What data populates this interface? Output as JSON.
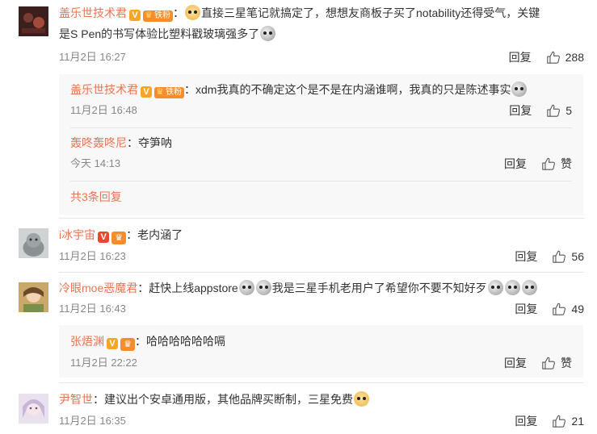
{
  "comments": [
    {
      "user": "盖乐世技术君",
      "text_a": "直接三星笔记就搞定了，想想友商板子买了notability还得受气，关键",
      "text_b": "是S Pen的书写体验比塑料戳玻璃强多了",
      "time": "11月2日 16:27",
      "reply": "回复",
      "likes": "288",
      "fan_badge": "铁粉",
      "vbadge": "V"
    },
    {
      "user": "i冰宇宙",
      "text": "老内涵了",
      "time": "11月2日 16:23",
      "reply": "回复",
      "likes": "56",
      "vbadge": "V"
    },
    {
      "user": "冷眼moe恶魔君",
      "text_a": "赶快上线appstore",
      "text_b": "我是三星手机老用户了希望你不要不知好歹",
      "time": "11月2日 16:43",
      "reply": "回复",
      "likes": "49"
    },
    {
      "user": "尹智世",
      "text": "建议出个安卓通用版，其他品牌买断制，三星免费",
      "time": "11月2日 16:35",
      "reply": "回复",
      "likes": "21"
    }
  ],
  "subs1": [
    {
      "user": "盖乐世技术君",
      "text": "xdm我真的不确定这个是不是在内涵谁啊，我真的只是陈述事实",
      "time": "11月2日 16:48",
      "reply": "回复",
      "likes": "5",
      "fan_badge": "铁粉",
      "vbadge": "V"
    },
    {
      "user": "轰咚轰咚尼",
      "text": "夺笋呐",
      "time": "今天 14:13",
      "reply": "回复",
      "likes": "赞"
    }
  ],
  "more1": "共3条回复",
  "subs3": [
    {
      "user": "张焐渊",
      "text": "哈哈哈哈哈哈嗝",
      "time": "11月2日 22:22",
      "reply": "回复",
      "likes": "赞",
      "vbadge": "V"
    }
  ],
  "colors": {
    "username": "#eb7350",
    "vbadge": "#f6a623",
    "fanbadge": "#f58d2d",
    "subbox_bg": "#f8f8f8"
  }
}
